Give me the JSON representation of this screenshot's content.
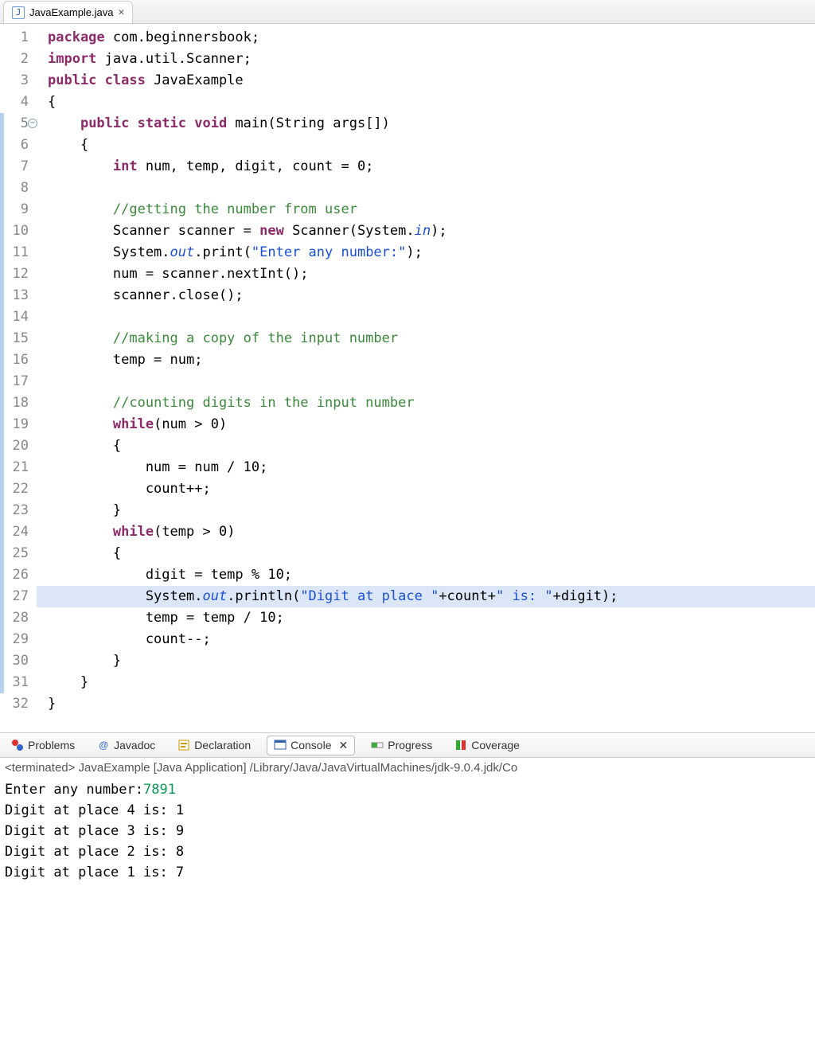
{
  "tab": {
    "filename": "JavaExample.java"
  },
  "code_lines": [
    {
      "n": 1,
      "blue": false,
      "hl": false,
      "tokens": [
        [
          "kw",
          "package"
        ],
        [
          "id",
          " com.beginnersbook;"
        ]
      ]
    },
    {
      "n": 2,
      "blue": false,
      "hl": false,
      "tokens": [
        [
          "kw",
          "import"
        ],
        [
          "id",
          " java.util.Scanner;"
        ]
      ]
    },
    {
      "n": 3,
      "blue": false,
      "hl": false,
      "tokens": [
        [
          "kw",
          "public class"
        ],
        [
          "id",
          " JavaExample"
        ]
      ]
    },
    {
      "n": 4,
      "blue": false,
      "hl": false,
      "tokens": [
        [
          "id",
          "{"
        ]
      ]
    },
    {
      "n": 5,
      "blue": true,
      "hl": false,
      "fold": true,
      "tokens": [
        [
          "id",
          "    "
        ],
        [
          "kw",
          "public static void"
        ],
        [
          "id",
          " main(String args[])"
        ]
      ]
    },
    {
      "n": 6,
      "blue": true,
      "hl": false,
      "tokens": [
        [
          "id",
          "    {"
        ]
      ]
    },
    {
      "n": 7,
      "blue": true,
      "hl": false,
      "tokens": [
        [
          "id",
          "        "
        ],
        [
          "kw",
          "int"
        ],
        [
          "id",
          " num, temp, digit, count = 0;"
        ]
      ]
    },
    {
      "n": 8,
      "blue": true,
      "hl": false,
      "tokens": [
        [
          "id",
          ""
        ]
      ]
    },
    {
      "n": 9,
      "blue": true,
      "hl": false,
      "tokens": [
        [
          "id",
          "        "
        ],
        [
          "cm",
          "//getting the number from user"
        ]
      ]
    },
    {
      "n": 10,
      "blue": true,
      "hl": false,
      "tokens": [
        [
          "id",
          "        Scanner scanner = "
        ],
        [
          "kw",
          "new"
        ],
        [
          "id",
          " Scanner(System."
        ],
        [
          "it",
          "in"
        ],
        [
          "id",
          ");"
        ]
      ]
    },
    {
      "n": 11,
      "blue": true,
      "hl": false,
      "tokens": [
        [
          "id",
          "        System."
        ],
        [
          "it",
          "out"
        ],
        [
          "id",
          ".print("
        ],
        [
          "str",
          "\"Enter any number:\""
        ],
        [
          "id",
          ");"
        ]
      ]
    },
    {
      "n": 12,
      "blue": true,
      "hl": false,
      "tokens": [
        [
          "id",
          "        num = scanner.nextInt();"
        ]
      ]
    },
    {
      "n": 13,
      "blue": true,
      "hl": false,
      "tokens": [
        [
          "id",
          "        scanner.close();"
        ]
      ]
    },
    {
      "n": 14,
      "blue": true,
      "hl": false,
      "tokens": [
        [
          "id",
          ""
        ]
      ]
    },
    {
      "n": 15,
      "blue": true,
      "hl": false,
      "tokens": [
        [
          "id",
          "        "
        ],
        [
          "cm",
          "//making a copy of the input number"
        ]
      ]
    },
    {
      "n": 16,
      "blue": true,
      "hl": false,
      "tokens": [
        [
          "id",
          "        temp = num;"
        ]
      ]
    },
    {
      "n": 17,
      "blue": true,
      "hl": false,
      "tokens": [
        [
          "id",
          ""
        ]
      ]
    },
    {
      "n": 18,
      "blue": true,
      "hl": false,
      "tokens": [
        [
          "id",
          "        "
        ],
        [
          "cm",
          "//counting digits in the input number"
        ]
      ]
    },
    {
      "n": 19,
      "blue": true,
      "hl": false,
      "tokens": [
        [
          "id",
          "        "
        ],
        [
          "kw",
          "while"
        ],
        [
          "id",
          "(num > 0)"
        ]
      ]
    },
    {
      "n": 20,
      "blue": true,
      "hl": false,
      "tokens": [
        [
          "id",
          "        {"
        ]
      ]
    },
    {
      "n": 21,
      "blue": true,
      "hl": false,
      "tokens": [
        [
          "id",
          "            num = num / 10;"
        ]
      ]
    },
    {
      "n": 22,
      "blue": true,
      "hl": false,
      "tokens": [
        [
          "id",
          "            count++;"
        ]
      ]
    },
    {
      "n": 23,
      "blue": true,
      "hl": false,
      "tokens": [
        [
          "id",
          "        }"
        ]
      ]
    },
    {
      "n": 24,
      "blue": true,
      "hl": false,
      "tokens": [
        [
          "id",
          "        "
        ],
        [
          "kw",
          "while"
        ],
        [
          "id",
          "(temp > 0)"
        ]
      ]
    },
    {
      "n": 25,
      "blue": true,
      "hl": false,
      "tokens": [
        [
          "id",
          "        {"
        ]
      ]
    },
    {
      "n": 26,
      "blue": true,
      "hl": false,
      "tokens": [
        [
          "id",
          "            digit = temp % 10;"
        ]
      ]
    },
    {
      "n": 27,
      "blue": true,
      "hl": true,
      "tokens": [
        [
          "id",
          "            System."
        ],
        [
          "it",
          "out"
        ],
        [
          "id",
          ".println("
        ],
        [
          "str",
          "\"Digit at place \""
        ],
        [
          "id",
          "+count+"
        ],
        [
          "str",
          "\" is: \""
        ],
        [
          "id",
          "+digit);"
        ]
      ]
    },
    {
      "n": 28,
      "blue": true,
      "hl": false,
      "tokens": [
        [
          "id",
          "            temp = temp / 10;"
        ]
      ]
    },
    {
      "n": 29,
      "blue": true,
      "hl": false,
      "tokens": [
        [
          "id",
          "            count--;"
        ]
      ]
    },
    {
      "n": 30,
      "blue": true,
      "hl": false,
      "tokens": [
        [
          "id",
          "        }"
        ]
      ]
    },
    {
      "n": 31,
      "blue": true,
      "hl": false,
      "tokens": [
        [
          "id",
          "    }"
        ]
      ]
    },
    {
      "n": 32,
      "blue": false,
      "hl": false,
      "tokens": [
        [
          "id",
          "}"
        ]
      ]
    }
  ],
  "bottom_tabs": {
    "problems": "Problems",
    "javadoc": "Javadoc",
    "declaration": "Declaration",
    "console": "Console",
    "progress": "Progress",
    "coverage": "Coverage"
  },
  "console": {
    "status": "<terminated> JavaExample [Java Application] /Library/Java/JavaVirtualMachines/jdk-9.0.4.jdk/Co",
    "prompt": "Enter any number:",
    "input": "7891",
    "out_lines": [
      "Digit at place 4 is: 1",
      "Digit at place 3 is: 9",
      "Digit at place 2 is: 8",
      "Digit at place 1 is: 7"
    ]
  }
}
